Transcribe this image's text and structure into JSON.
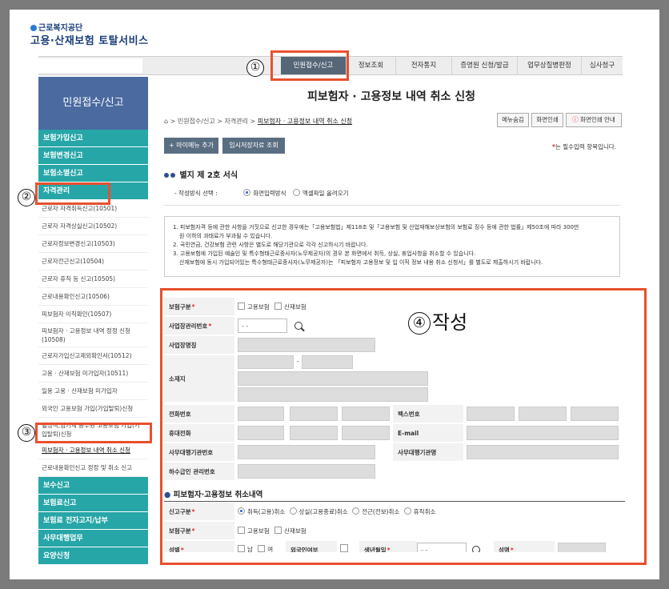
{
  "brand": {
    "org": "근로복지공단",
    "service": "고용·산재보험 토탈서비스"
  },
  "topnav": [
    "민원접수/신고",
    "정보조회",
    "전자통지",
    "증명원 신청/발급",
    "업무상질병판정",
    "심사청구"
  ],
  "sidebar": {
    "heading": "민원접수/신고",
    "groups_top": [
      "보험가입신고",
      "보험변경신고",
      "보험소멸신고",
      "자격관리"
    ],
    "subitems": [
      "근로자 자격취득신고(10501)",
      "근로자 자격상실신고(10502)",
      "근로자정보변경신고(10503)",
      "근로자전근신고(10504)",
      "근로자 휴직 등 신고(10505)",
      "근로내용확인신고(10506)",
      "피보험자 이직확인(10507)",
      "피보험자 · 고용정보 내역 정정 신청(10508)",
      "근로자가입신고제외확인서(10512)",
      "고용 · 산재보험 미가입자(10511)",
      "일용 고용 · 산재보험 미가입자",
      "외국인 고용보험 가입(가입탈퇴)신청",
      "별정직,임기제 공무원 고용보험 가입(가입탈퇴)신청",
      "피보험자 · 고용정보 내역 취소 신청",
      "근로내용확인신고 정정 및 취소 신고"
    ],
    "groups_bottom": [
      "보수신고",
      "보험료신고",
      "보험료 전자고지/납부",
      "사무대행업무",
      "요양신청"
    ]
  },
  "page": {
    "title": "피보험자 · 고용정보 내역 취소 신청",
    "breadcrumb": [
      "민원접수/신고",
      "자격관리",
      "피보험자 · 고용정보 내역 취소 신청"
    ]
  },
  "buttons": {
    "menu_save": "메뉴숨김",
    "print": "화면인쇄",
    "print_guide": "화면인쇄 안내",
    "add_menu": "+ 마이메뉴 추가",
    "temp_lookup": "임시저장자료 조회"
  },
  "required_note": {
    "star": "*",
    "text": "는 필수입력 항목입니다."
  },
  "section1": {
    "title": "별지 제 2호 서식",
    "method_label": "- 작성방식 선택 :",
    "opt1": "화면입력방식",
    "opt2": "엑셀파일 올려오기"
  },
  "notice": [
    "1. 피보험자격 등에 관한 사항을 거짓으로 신고한 경우에는「고용보험법」제118조 및「고용보험 및 산업재해보상보험의 보험료 징수 등에 관한 법률」제50조에 따라 300만",
    "원 이하의 과태료가 부과될 수 있습니다.",
    "2. 국민연금, 건강보험 관련 사항은 별도로 해당기관으로 각각 신고하시기 바랍니다.",
    "3. 고용보험에 가입된 예술인 및 특수형태근로종사자(노무제공자)의 경우 본 화면에서 취득, 상실, 휴업사항을 취소할 수 있습니다.",
    "산재보험에 동시 가입되어있는 특수형태근로종사자(노무제공자)는 「피보험자 고용정보 및 입 이직 정보 내용 취소 신청서」를 별도로 제출하시기 바랍니다."
  ],
  "form": {
    "insurance_type": "보험구분",
    "emp_ins": "고용보험",
    "ind_ins": "산재보험",
    "biz_no": "사업장관리번호",
    "biz_no_value": "-  -",
    "biz_name": "사업장명칭",
    "address": "소재지",
    "addr_dash": "-",
    "phone": "전화번호",
    "fax": "팩스번호",
    "mobile": "휴대전화",
    "email": "E-mail",
    "agent_no": "사무대행기관번호",
    "agent_name": "사무대행기관명",
    "sub_no": "하수급인 관리번호",
    "section2": "피보험자·고용정보 취소내역",
    "report_type": "신고구분",
    "rt_opts": [
      "취득(고용)취소",
      "상실(고용종료)취소",
      "전근(전보)취소",
      "휴직취소"
    ],
    "ins_type2": "보험구분",
    "gender": "성별",
    "male": "남",
    "female": "여",
    "foreigner": "외국인여부",
    "birth": "생년월일",
    "birth_value": "- -",
    "name": "성명"
  },
  "annotations": {
    "c1": "①",
    "c2": "②",
    "c3": "③",
    "c4": "④",
    "c4_text": "작성"
  }
}
